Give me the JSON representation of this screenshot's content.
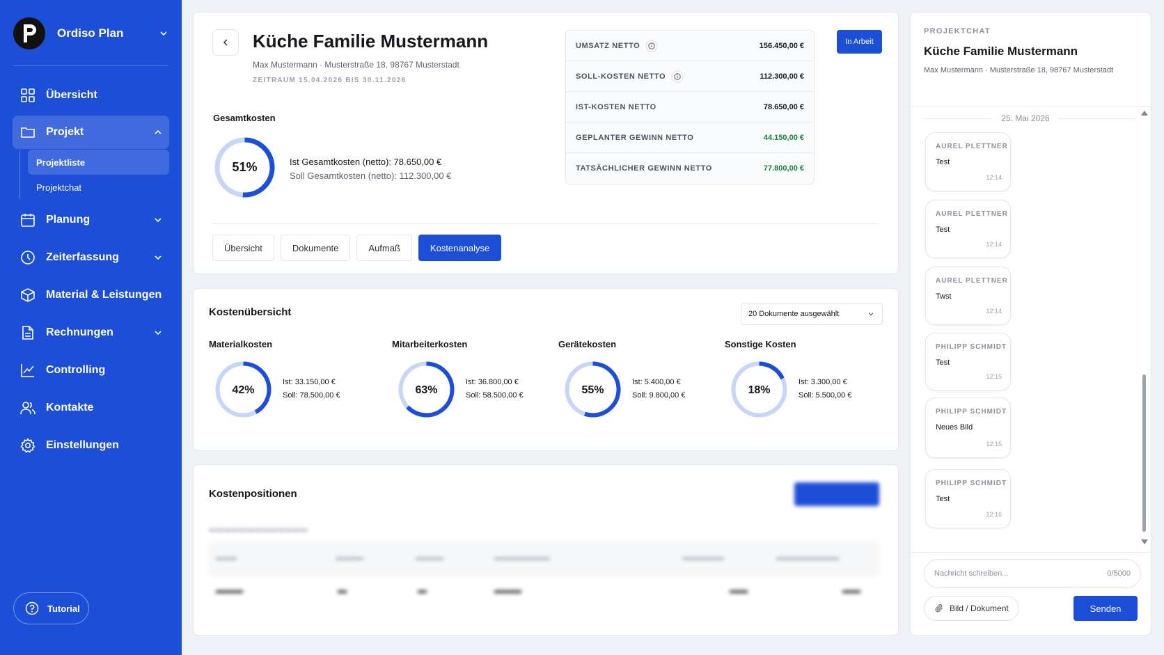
{
  "sidebar": {
    "brand": "Ordiso Plan",
    "items": [
      {
        "label": "Übersicht"
      },
      {
        "label": "Projekt"
      },
      {
        "label": "Planung"
      },
      {
        "label": "Zeiterfassung"
      },
      {
        "label": "Material & Leistungen"
      },
      {
        "label": "Rechnungen"
      },
      {
        "label": "Controlling"
      },
      {
        "label": "Kontakte"
      },
      {
        "label": "Einstellungen"
      }
    ],
    "sub_items": [
      {
        "label": "Projektliste"
      },
      {
        "label": "Projektchat"
      }
    ],
    "tutorial": "Tutorial"
  },
  "project": {
    "title": "Küche Familie Mustermann",
    "subtitle": "Max Mustermann · Musterstraße 18, 98767 Musterstadt",
    "range": "ZEITRAUM 15.04.2026 BIS 30.11.2026",
    "status": "In Arbeit"
  },
  "gesamtkosten": {
    "title": "Gesamtkosten",
    "percent": "51%",
    "fraction": 0.51,
    "ist": "Ist Gesamtkosten (netto): 78.650,00 €",
    "soll": "Soll Gesamtkosten (netto): 112.300,00 €"
  },
  "kpis": [
    {
      "label": "UMSATZ NETTO",
      "value": "156.450,00 €",
      "color": "#16181d"
    },
    {
      "label": "SOLL-KOSTEN NETTO",
      "value": "112.300,00 €",
      "color": "#16181d"
    },
    {
      "label": "IST-KOSTEN NETTO",
      "value": "78.650,00 €",
      "color": "#16181d"
    },
    {
      "label": "GEPLANTER GEWINN NETTO",
      "value": "44.150,00 €",
      "color": "#15803d"
    },
    {
      "label": "TATSÄCHLICHER GEWINN NETTO",
      "value": "77.800,00 €",
      "color": "#15803d"
    }
  ],
  "tabs": [
    {
      "label": "Übersicht"
    },
    {
      "label": "Dokumente"
    },
    {
      "label": "Aufmaß"
    },
    {
      "label": "Kostenanalyse"
    }
  ],
  "kostenuebersicht": {
    "title": "Kostenübersicht",
    "select": "20 Dokumente ausgewählt",
    "items": [
      {
        "title": "Materialkosten",
        "percent": "42%",
        "fraction": 0.42,
        "ist": "Ist: 33.150,00 €",
        "soll": "Soll: 78.500,00 €"
      },
      {
        "title": "Mitarbeiterkosten",
        "percent": "63%",
        "fraction": 0.63,
        "ist": "Ist: 36.800,00 €",
        "soll": "Soll: 58.500,00 €"
      },
      {
        "title": "Gerätekosten",
        "percent": "55%",
        "fraction": 0.55,
        "ist": "Ist: 5.400,00 €",
        "soll": "Soll: 9.800,00 €"
      },
      {
        "title": "Sonstige Kosten",
        "percent": "18%",
        "fraction": 0.18,
        "ist": "Ist: 3.300,00 €",
        "soll": "Soll: 5.500,00 €"
      }
    ]
  },
  "kostenpositionen": {
    "title": "Kostenpositionen"
  },
  "chat": {
    "label": "PROJEKTCHAT",
    "title": "Küche Familie Mustermann",
    "subtitle": "Max Mustermann · Musterstraße 18, 98767 Musterstadt",
    "date": "25. Mai 2026",
    "messages": [
      {
        "author": "AUREL PLETTNER",
        "text": "Test",
        "time": "12:14"
      },
      {
        "author": "AUREL PLETTNER",
        "text": "Test",
        "time": "12:14"
      },
      {
        "author": "AUREL PLETTNER",
        "text": "Twst",
        "time": "12:14"
      },
      {
        "author": "PHILIPP SCHMIDT",
        "text": "Test",
        "time": "12:15"
      },
      {
        "author": "PHILIPP SCHMIDT",
        "text": "Neues Bild",
        "time": "12:15"
      },
      {
        "author": "PHILIPP SCHMIDT",
        "text": "Test",
        "time": "12:16"
      }
    ],
    "input_placeholder": "Nachricht schreiben...",
    "counter": "0/5000",
    "attach": "Bild / Dokument",
    "send": "Senden"
  },
  "colors": {
    "primary": "#1d4ed8",
    "ring_track": "#c7d6f7",
    "success": "#15803d"
  }
}
